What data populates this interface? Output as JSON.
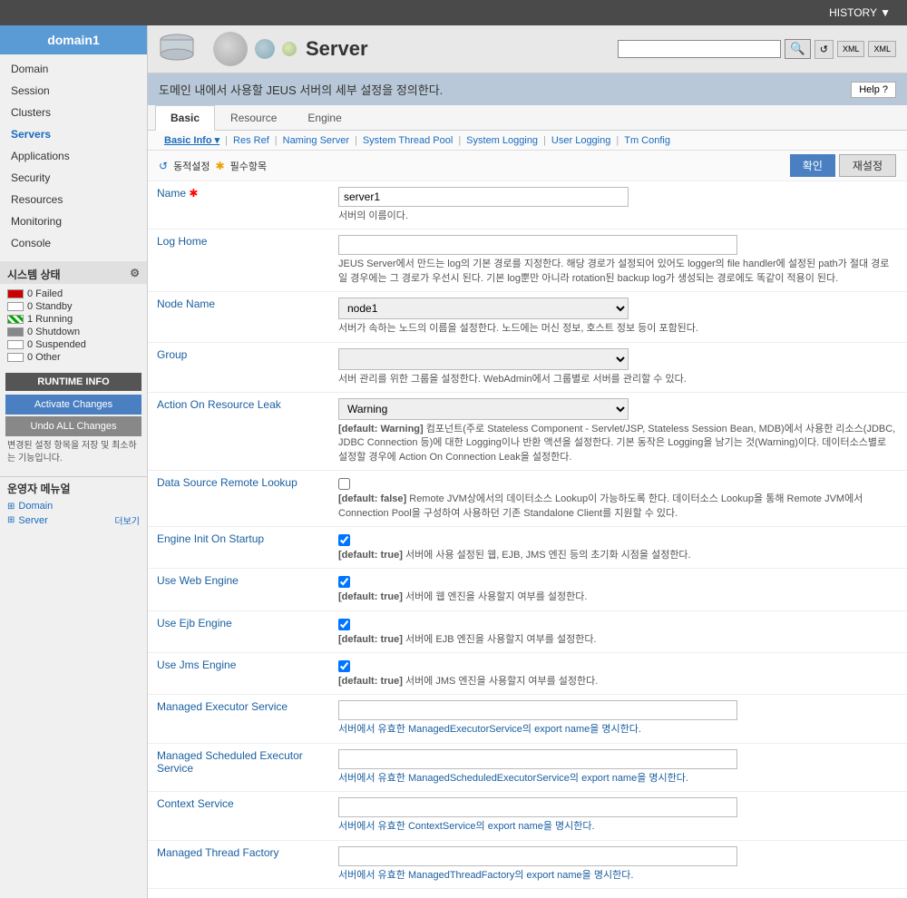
{
  "app": {
    "history_btn": "HISTORY ▼",
    "domain_title": "domain1"
  },
  "sidebar": {
    "nav_items": [
      {
        "label": "Domain",
        "active": false
      },
      {
        "label": "Session",
        "active": false
      },
      {
        "label": "Clusters",
        "active": false
      },
      {
        "label": "Servers",
        "active": true
      },
      {
        "label": "Applications",
        "active": false
      },
      {
        "label": "Security",
        "active": false
      },
      {
        "label": "Resources",
        "active": false
      },
      {
        "label": "Monitoring",
        "active": false
      },
      {
        "label": "Console",
        "active": false
      }
    ],
    "system_status_title": "시스템 상태",
    "status_items": [
      {
        "label": "0 Failed"
      },
      {
        "label": "0 Standby"
      },
      {
        "label": "1 Running"
      },
      {
        "label": "0 Shutdown"
      },
      {
        "label": "0 Suspended"
      },
      {
        "label": "0 Other"
      }
    ],
    "runtime_info_btn": "RUNTIME INFO",
    "activate_changes_btn": "Activate Changes",
    "undo_all_changes_btn": "Undo ALL Changes",
    "runtime_desc": "변경된 설정 항목을 저장 및 최소하는 기능입니다.",
    "ops_menu_title": "운영자 메뉴얼",
    "ops_items": [
      {
        "icon": "table-icon",
        "label": "Domain"
      },
      {
        "icon": "table-icon",
        "label": "Server"
      }
    ],
    "ops_more": "더보기"
  },
  "header": {
    "server_label": "Server",
    "description": "도메인 내에서 사용할 JEUS 서버의 세부 설정을 정의한다.",
    "help_btn": "Help ?",
    "search_placeholder": ""
  },
  "tabs": [
    {
      "label": "Basic",
      "active": true
    },
    {
      "label": "Resource",
      "active": false
    },
    {
      "label": "Engine",
      "active": false
    }
  ],
  "sub_nav": {
    "items": [
      {
        "label": "Basic Info",
        "active": true
      },
      {
        "label": "Res Ref"
      },
      {
        "label": "Naming Server"
      },
      {
        "label": "System Thread Pool"
      },
      {
        "label": "System Logging"
      },
      {
        "label": "User Logging"
      },
      {
        "label": "Tm Config"
      }
    ]
  },
  "action_bar": {
    "dynamic_setting": "동적설정",
    "required_items": "필수항목",
    "confirm_btn": "확인",
    "reset_btn": "재설정"
  },
  "form": {
    "fields": [
      {
        "label": "Name",
        "required": true,
        "type": "input",
        "value": "server1",
        "desc": "서버의 이름이다."
      },
      {
        "label": "Log Home",
        "required": false,
        "type": "input",
        "value": "",
        "desc": "JEUS Server에서 만드는 log의 기본 경로를 지정한다. 해당 경로가 설정되어 있어도 logger의 file handler에 설정된 path가 절대 경로일 경우에는 그 경로가 우선시 된다. 기본 log뿐만 아니라 rotation된 backup log가 생성되는 경로에도 똑같이 적용이 된다."
      },
      {
        "label": "Node Name",
        "required": false,
        "type": "select",
        "value": "node1",
        "desc": "서버가 속하는 노드의 이름을 설정한다. 노드에는 머신 정보, 호스트 정보 등이 포함된다."
      },
      {
        "label": "Group",
        "required": false,
        "type": "select",
        "value": "",
        "desc": "서버 관리를 위한 그룹을 설정한다. WebAdmin에서 그룹별로 서버를 관리할 수 있다."
      },
      {
        "label": "Action On Resource Leak",
        "required": false,
        "type": "select",
        "value": "Warning",
        "desc": "[default: Warning]  컴포넌트(주로 Stateless Component - Servlet/JSP, Stateless Session Bean, MDB)에서 사용한 리소스(JDBC, JDBC Connection 등)에 대한 Logging이나 반환 액션을 설정한다. 기본 동작은 Logging을 남기는 것(Warning)이다. 데이터소스별로 설정할 경우에 Action On Connection Leak을 설정한다."
      },
      {
        "label": "Data Source Remote Lookup",
        "required": false,
        "type": "checkbox",
        "checked": false,
        "desc": "[default: false]  Remote JVM상에서의 데이터소스 Lookup이 가능하도록 한다. 데이터소스 Lookup을 통해 Remote JVM에서 Connection Pool을 구성하여 사용하던 기존 Standalone Client를 지원할 수 있다."
      },
      {
        "label": "Engine Init On Startup",
        "required": false,
        "type": "checkbox",
        "checked": true,
        "desc": "[default: true]  서버에 사용 설정된 웹, EJB, JMS 엔진 등의 초기화 시점을 설정한다."
      },
      {
        "label": "Use Web Engine",
        "required": false,
        "type": "checkbox",
        "checked": true,
        "desc": "[default: true]  서버에 웹 엔진을 사용할지 여부를 설정한다."
      },
      {
        "label": "Use Ejb Engine",
        "required": false,
        "type": "checkbox",
        "checked": true,
        "desc": "[default: true]  서버에 EJB 엔진을 사용할지 여부를 설정한다."
      },
      {
        "label": "Use Jms Engine",
        "required": false,
        "type": "checkbox",
        "checked": true,
        "desc": "[default: true]  서버에 JMS 엔진을 사용할지 여부를 설정한다."
      },
      {
        "label": "Managed Executor Service",
        "required": false,
        "type": "input",
        "value": "",
        "desc": "서버에서 유효한 ManagedExecutorService의 export name을 명시한다."
      },
      {
        "label": "Managed Scheduled Executor Service",
        "required": false,
        "type": "input",
        "value": "",
        "desc": "서버에서 유효한 ManagedScheduledExecutorService의 export name을 명시한다."
      },
      {
        "label": "Context Service",
        "required": false,
        "type": "input",
        "value": "",
        "desc": "서버에서 유효한 ContextService의 export name을 명시한다."
      },
      {
        "label": "Managed Thread Factory",
        "required": false,
        "type": "input",
        "value": "",
        "desc": "서버에서 유효한 ManagedThreadFactory의 export name을 명시한다."
      }
    ]
  }
}
